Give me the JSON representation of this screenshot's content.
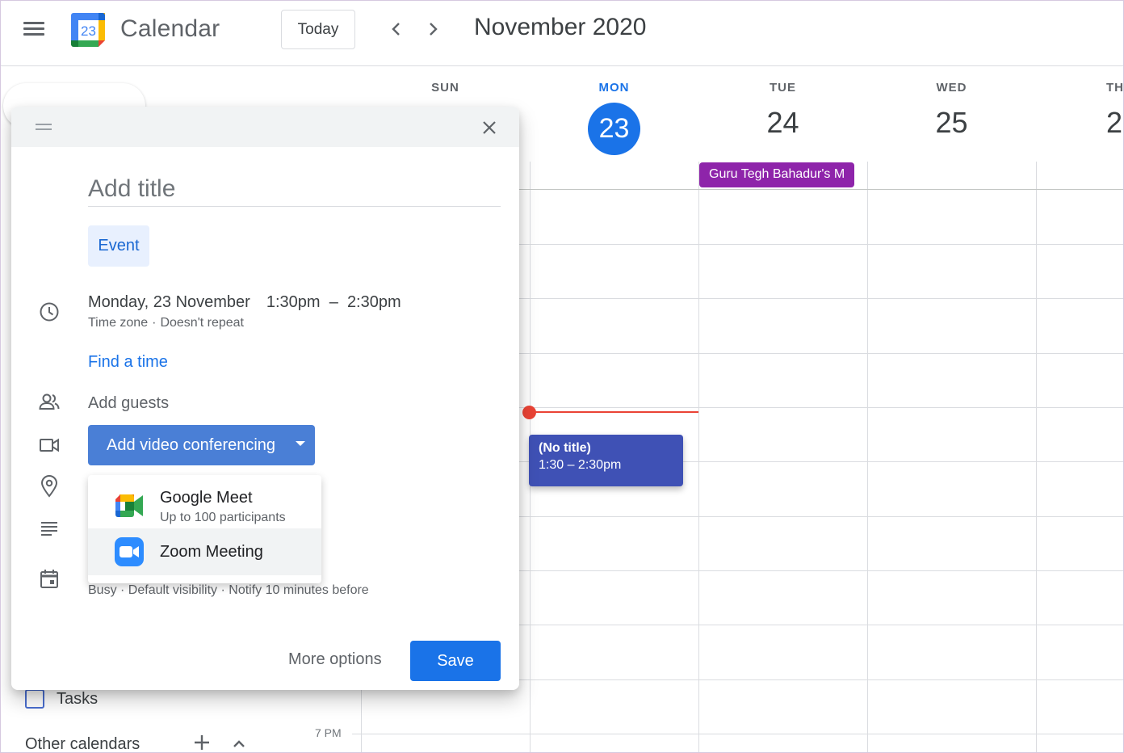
{
  "header": {
    "app_title": "Calendar",
    "logo_day": "23",
    "today_label": "Today",
    "month_title": "November 2020"
  },
  "days": [
    {
      "dow": "SUN",
      "date": ""
    },
    {
      "dow": "MON",
      "date": "23",
      "is_today": true
    },
    {
      "dow": "TUE",
      "date": "24"
    },
    {
      "dow": "WED",
      "date": "25"
    },
    {
      "dow": "TH",
      "date": "2"
    }
  ],
  "events": {
    "all_day": {
      "label": "Guru Tegh Bahadur's M",
      "color": "#8e24aa"
    },
    "timed": {
      "title": "(No title)",
      "time": "1:30 – 2:30pm",
      "color": "#3f51b5"
    }
  },
  "dialog": {
    "title_placeholder": "Add title",
    "event_chip": "Event",
    "date": "Monday, 23 November",
    "start_time": "1:30pm",
    "dash": "–",
    "end_time": "2:30pm",
    "time_zone": "Time zone",
    "sep": "·",
    "repeat": "Doesn't repeat",
    "find_time": "Find a time",
    "add_guests": "Add guests",
    "video_button": "Add video conferencing",
    "visibility_row": "Busy · Default visibility · Notify 10 minutes before",
    "more_options": "More options",
    "save": "Save"
  },
  "dropdown": {
    "items": [
      {
        "title": "Google Meet",
        "subtitle": "Up to 100 participants",
        "icon": "google-meet-icon"
      },
      {
        "title": "Zoom Meeting",
        "icon": "zoom-icon"
      }
    ]
  },
  "sidebar": {
    "tasks_label": "Tasks",
    "other_calendars": "Other calendars",
    "time_label_7pm": "7 PM"
  },
  "colors": {
    "accent": "#1a73e8",
    "now_line": "#ea4335",
    "video_button": "#4a7fd6"
  }
}
